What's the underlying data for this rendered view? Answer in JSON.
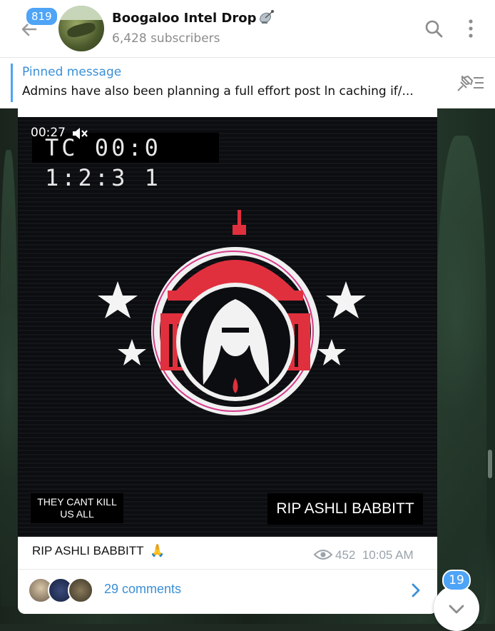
{
  "header": {
    "unread_count": "819",
    "channel_name": "Boogaloo Intel Drop",
    "channel_icon": "satellite-dish-icon",
    "subscribers": "6,428 subscribers"
  },
  "pinned": {
    "label": "Pinned message",
    "text": "Admins have also been planning a full effort post ln caching if/..."
  },
  "message": {
    "video_duration": "00:27",
    "timecode": "TC 00:0 1:2:3 1",
    "overlay_left": [
      "THEY CANT KILL",
      "US ALL"
    ],
    "overlay_right": "RIP ASHLI BABBITT",
    "text": "RIP ASHLI BABBITT",
    "emoji": "🙏",
    "views": "452",
    "time": "10:05 AM",
    "comments": "29 comments"
  },
  "scroll": {
    "unread_count": "19"
  },
  "colors": {
    "accent": "#4ea4f6",
    "link": "#3a8fd6",
    "logo_red": "#e0303e"
  }
}
